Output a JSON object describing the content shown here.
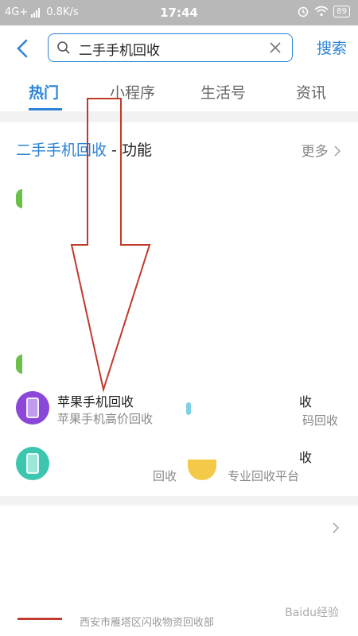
{
  "status_bar": {
    "network": "4G+",
    "speed": "0.8K/s",
    "time": "17:44",
    "battery": "89"
  },
  "search": {
    "query": "二手手机回收",
    "button_label": "搜索"
  },
  "tabs": [
    {
      "label": "热门",
      "active": true
    },
    {
      "label": "小程序"
    },
    {
      "label": "生活号"
    },
    {
      "label": "资讯"
    }
  ],
  "section": {
    "title_keyword": "二手手机回收",
    "title_suffix": " - 功能",
    "more_label": "更多"
  },
  "items": [
    {
      "name": "苹果手机回收",
      "desc": "苹果手机高价回收",
      "icon": "purple-phone-icon",
      "color": "#8a47d8"
    },
    {
      "name": "",
      "desc": "回收",
      "icon": "teal-phone-icon",
      "color": "#3cc6b0"
    }
  ],
  "right_partial": {
    "r1_name": "收",
    "r1_desc": "码回收",
    "r2_name": "收",
    "r2_desc": "专业回收平台"
  },
  "footer": {
    "partial_text": "西安市雁塔区闪收物资回收部",
    "watermark": "Baidu经验"
  },
  "colors": {
    "accent": "#2b83d6",
    "annotation_red": "#c0392b"
  }
}
